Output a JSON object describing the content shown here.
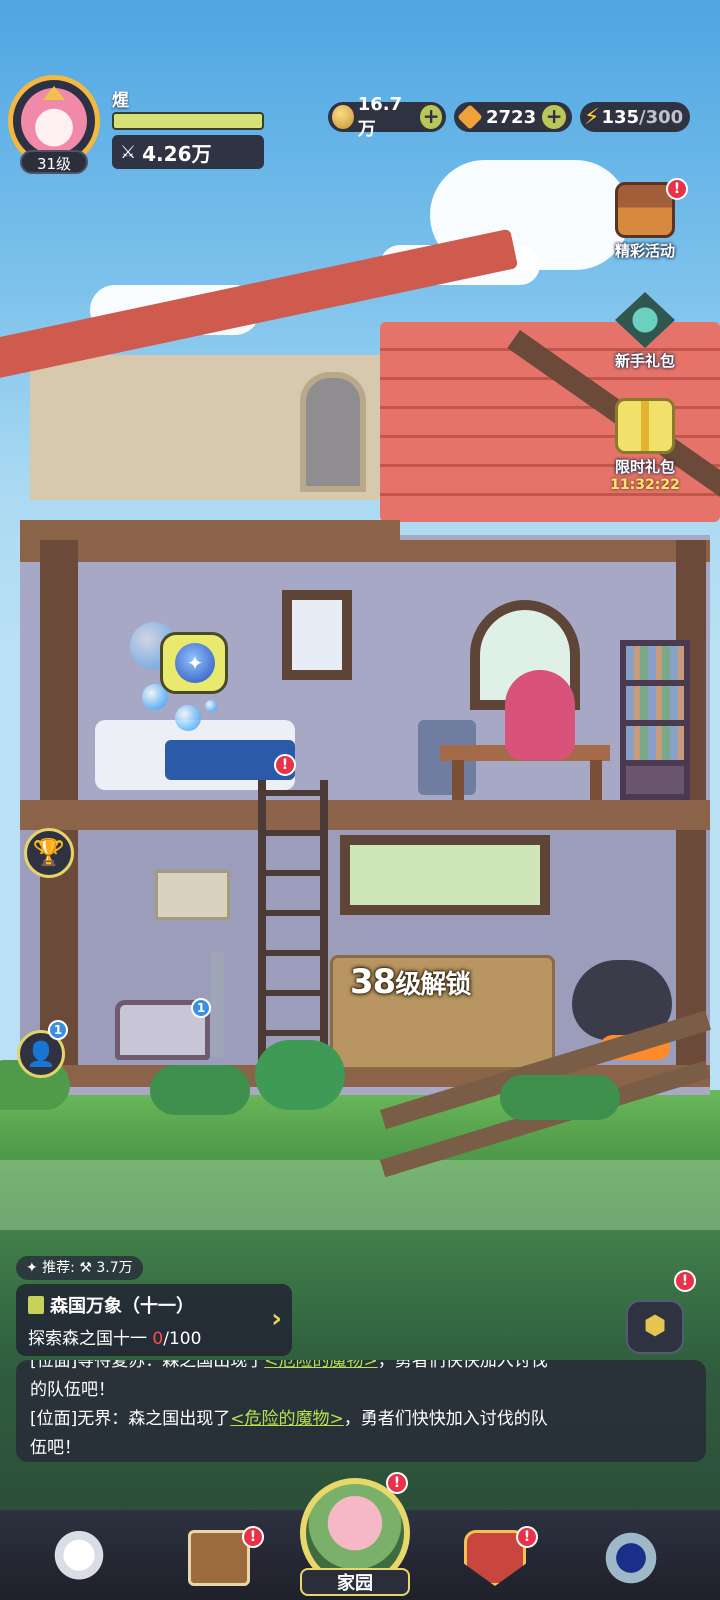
{
  "player": {
    "name": "煋",
    "level": "31级",
    "power": "4.26万",
    "power_icon": "crossed-swords-icon"
  },
  "resources": {
    "coins": "16.7万",
    "gems": "2723",
    "energy_current": "135",
    "energy_max": "/300"
  },
  "side_buttons": {
    "events": {
      "label": "精彩活动",
      "badge": "!"
    },
    "newbie_pack": {
      "label": "新手礼包"
    },
    "limited_pack": {
      "label": "限时礼包",
      "timer": "11:32:22"
    }
  },
  "scene": {
    "unlock_number": "38",
    "unlock_suffix": "级解锁",
    "bed_badge": "!",
    "chest_badge": "1",
    "friend_badge": "1"
  },
  "quest": {
    "recommended": "✦ 推荐: ⚒ 3.7万",
    "title": "森国万象（十一）",
    "progress_label": "探索森之国十一 ",
    "progress_current": "0",
    "progress_total": "/100",
    "box_badge": "!"
  },
  "chat": {
    "line1_text": "[位面]等待复苏：森之国出现了",
    "line1_link": "<危险的魔物>",
    "line1_tail": "，勇者们快快加入讨伐",
    "line2": "的队伍吧！",
    "line3_text": "[位面]无界：森之国出现了",
    "line3_link": "<危险的魔物>",
    "line3_tail": "，勇者们快快加入讨伐的队",
    "line4": "伍吧！"
  },
  "nav": {
    "home_label": "家园",
    "badges": {
      "book": "!",
      "home": "!",
      "shield": "!"
    }
  },
  "colors": {
    "accent_yellow": "#e8d86a",
    "alert_red": "#e8324a",
    "link_green": "#b3e34d",
    "progress_red": "#ff4b4b"
  }
}
